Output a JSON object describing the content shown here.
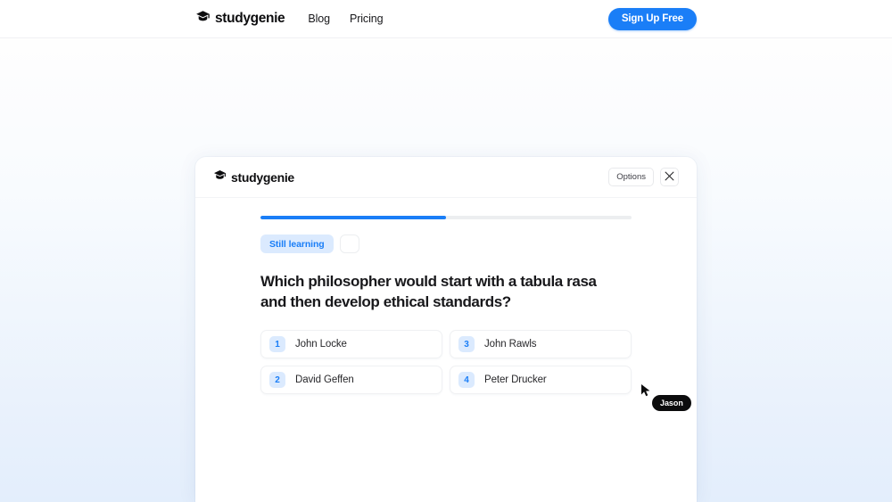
{
  "topnav": {
    "brand": {
      "icon": "graduation-cap-icon",
      "name": "studygenie"
    },
    "links": [
      {
        "label": "Blog"
      },
      {
        "label": "Pricing"
      }
    ],
    "cta": {
      "label": "Sign Up Free",
      "color": "#1a7ef7"
    }
  },
  "app_card": {
    "header": {
      "brand": {
        "icon": "graduation-cap-icon",
        "name": "studygenie"
      },
      "options_label": "Options",
      "close_icon": "close-icon"
    },
    "progress": {
      "percent": 50,
      "fill_color": "#1a7ef7",
      "track_color": "#eceef0"
    },
    "status": {
      "badge_label": "Still learning",
      "badge_bg": "#dbeafe",
      "badge_color": "#1a7ef7"
    },
    "question": "Which philosopher would start with a tabula rasa and then develop ethical standards?",
    "answers": [
      {
        "number": "1",
        "label": "John Locke"
      },
      {
        "number": "2",
        "label": "David Geffen"
      },
      {
        "number": "3",
        "label": "John Rawls"
      },
      {
        "number": "4",
        "label": "Peter Drucker"
      }
    ]
  },
  "cursor": {
    "label": "Jason",
    "pill_bg": "#0c0c0d"
  }
}
